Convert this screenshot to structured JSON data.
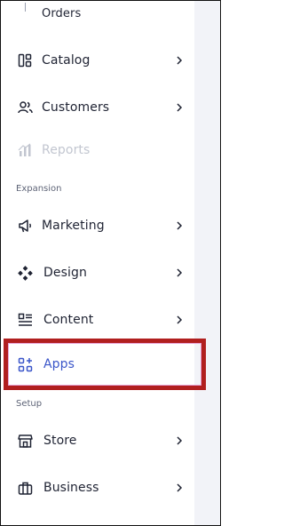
{
  "nav": {
    "orders": "Orders",
    "catalog": "Catalog",
    "customers": "Customers",
    "reports": "Reports",
    "section_expansion": "Expansion",
    "marketing": "Marketing",
    "design": "Design",
    "content": "Content",
    "apps": "Apps",
    "section_setup": "Setup",
    "store": "Store",
    "business": "Business"
  },
  "colors": {
    "accent": "#3b56c9",
    "highlight_border": "#b11f1f",
    "disabled": "#c2c6d0"
  },
  "icons": [
    "catalog-icon",
    "customers-icon",
    "reports-icon",
    "marketing-icon",
    "design-icon",
    "content-icon",
    "apps-icon",
    "store-icon",
    "business-icon"
  ]
}
